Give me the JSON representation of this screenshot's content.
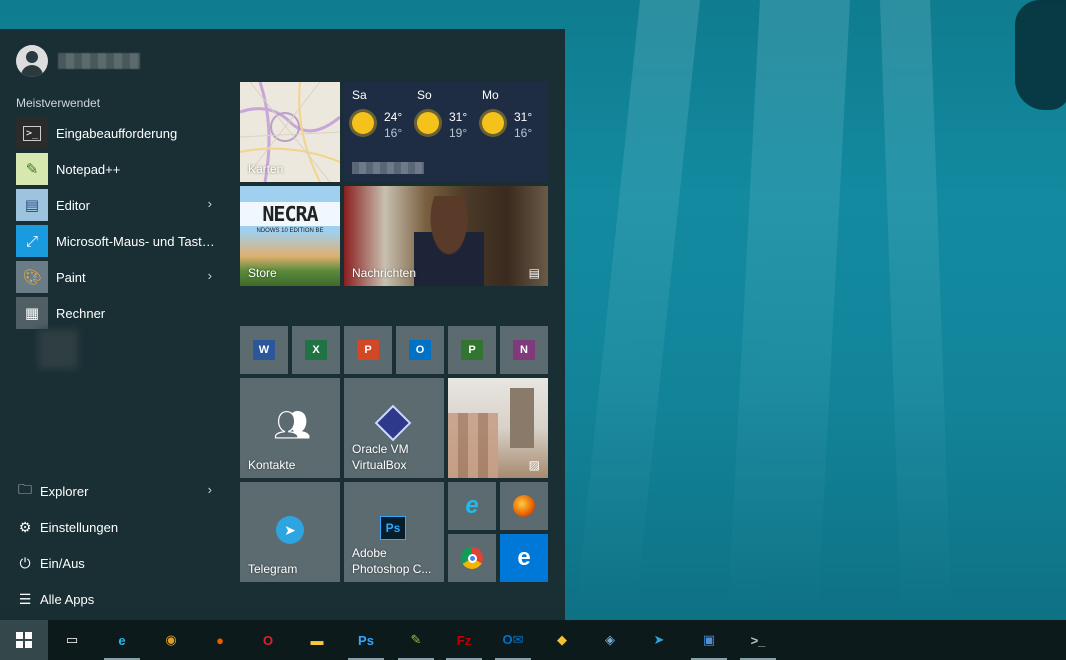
{
  "start_menu": {
    "user_name": "",
    "most_used_label": "Meistverwendet",
    "most_used": [
      {
        "label": "Eingabeaufforderung",
        "icon": "cmd-icon",
        "chevron": false
      },
      {
        "label": "Notepad++",
        "icon": "notepadpp-icon",
        "chevron": false
      },
      {
        "label": "Editor",
        "icon": "editor-icon",
        "chevron": true
      },
      {
        "label": "Microsoft-Maus- und Tastatu...",
        "icon": "mouse-keyboard-icon",
        "chevron": false
      },
      {
        "label": "Paint",
        "icon": "paint-icon",
        "chevron": true
      },
      {
        "label": "Rechner",
        "icon": "calculator-icon",
        "chevron": false
      }
    ],
    "bottom": [
      {
        "label": "Explorer",
        "icon": "explorer-icon",
        "chevron": true
      },
      {
        "label": "Einstellungen",
        "icon": "settings-icon",
        "chevron": false
      },
      {
        "label": "Ein/Aus",
        "icon": "power-icon",
        "chevron": false
      },
      {
        "label": "Alle Apps",
        "icon": "all-apps-icon",
        "chevron": false
      }
    ],
    "chevron_glyph": "›"
  },
  "tiles": {
    "maps": {
      "label": "Karten"
    },
    "weather": {
      "days": [
        {
          "name": "Sa",
          "high": "24°",
          "low": "16°"
        },
        {
          "name": "So",
          "high": "31°",
          "low": "19°"
        },
        {
          "name": "Mo",
          "high": "31°",
          "low": "16°"
        }
      ]
    },
    "store": {
      "label": "Store",
      "banner": "NECRA",
      "sub": "NDOWS 10 EDITION BE"
    },
    "news": {
      "label": "Nachrichten"
    },
    "office": [
      {
        "name": "word",
        "letter": "W",
        "color": "#2b579a"
      },
      {
        "name": "excel",
        "letter": "X",
        "color": "#217346"
      },
      {
        "name": "powerpoint",
        "letter": "P",
        "color": "#d24726"
      },
      {
        "name": "outlook",
        "letter": "O",
        "color": "#0072c6"
      },
      {
        "name": "project",
        "letter": "P",
        "color": "#31752f"
      },
      {
        "name": "onenote",
        "letter": "N",
        "color": "#80397b"
      }
    ],
    "contacts": {
      "label": "Kontakte"
    },
    "virtualbox": {
      "label_line1": "Oracle VM",
      "label_line2": "VirtualBox"
    },
    "telegram": {
      "label": "Telegram"
    },
    "photoshop": {
      "label_line1": "Adobe",
      "label_line2": "Photoshop C..."
    }
  },
  "taskbar": {
    "items": [
      {
        "name": "task-view",
        "glyph": "▭"
      },
      {
        "name": "internet-explorer",
        "glyph": "e",
        "color": "#1ebbee"
      },
      {
        "name": "chrome",
        "glyph": "◉",
        "color": "#e0a020"
      },
      {
        "name": "firefox",
        "glyph": "●",
        "color": "#e66000"
      },
      {
        "name": "opera",
        "glyph": "O",
        "color": "#e0202a"
      },
      {
        "name": "file-explorer",
        "glyph": "▬",
        "color": "#f5c842"
      },
      {
        "name": "photoshop",
        "glyph": "Ps",
        "color": "#31a8ff"
      },
      {
        "name": "notepadpp",
        "glyph": "✎",
        "color": "#8bc34a"
      },
      {
        "name": "filezilla",
        "glyph": "Fz",
        "color": "#bf0000"
      },
      {
        "name": "outlook",
        "glyph": "O✉",
        "color": "#0072c6"
      },
      {
        "name": "sandbox",
        "glyph": "◆",
        "color": "#f2c230"
      },
      {
        "name": "virtualbox",
        "glyph": "◈",
        "color": "#7aa9d4"
      },
      {
        "name": "telegram",
        "glyph": "➤",
        "color": "#2ca5e0"
      },
      {
        "name": "network-tool",
        "glyph": "▣",
        "color": "#4a90d9"
      },
      {
        "name": "cmd",
        "glyph": ">_",
        "color": "#c0c0c0"
      }
    ]
  }
}
